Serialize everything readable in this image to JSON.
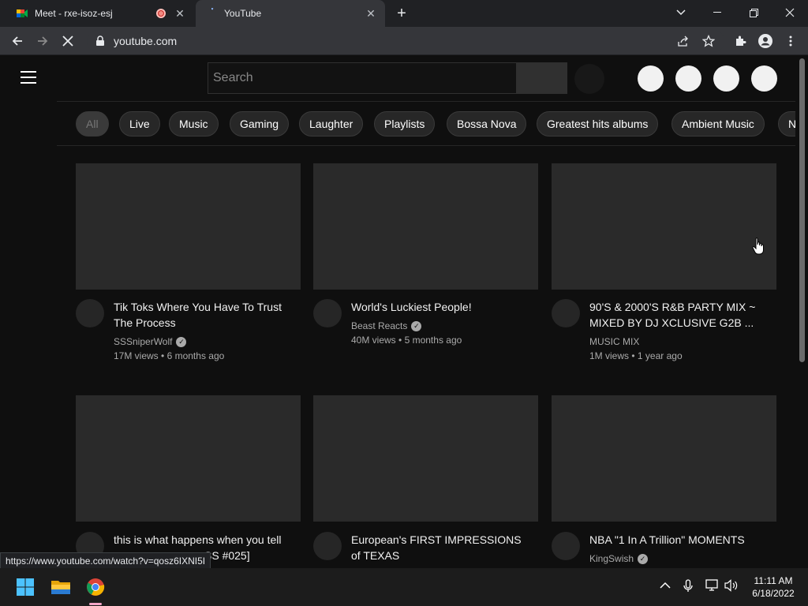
{
  "browser": {
    "tabs": [
      {
        "title": "Meet - rxe-isoz-esj",
        "active": false
      },
      {
        "title": "YouTube",
        "active": true
      }
    ],
    "url": "youtube.com",
    "status_url": "https://www.youtube.com/watch?v=qosz6IXNI5I"
  },
  "youtube": {
    "search_placeholder": "Search",
    "chips": [
      "All",
      "Live",
      "Music",
      "Gaming",
      "Laughter",
      "Playlists",
      "Bossa Nova",
      "Greatest hits albums",
      "Ambient Music",
      "N"
    ],
    "videos": [
      {
        "title": "Tik Toks Where You Have To Trust The Process",
        "channel": "SSSniperWolf",
        "verified": true,
        "views": "17M views",
        "age": "6 months ago"
      },
      {
        "title": "World's Luckiest People!",
        "channel": "Beast Reacts",
        "verified": true,
        "views": "40M views",
        "age": "5 months ago"
      },
      {
        "title": "90'S & 2000'S R&B PARTY MIX ~ MIXED BY DJ XCLUSIVE G2B ...",
        "channel": "MUSIC MIX",
        "verified": false,
        "views": "1M views",
        "age": "1 year ago"
      },
      {
        "title": "this is what happens when you tell",
        "title_line2": "SS #025]",
        "channel": "",
        "verified": false,
        "views": "",
        "age": ""
      },
      {
        "title": "European's FIRST IMPRESSIONS of TEXAS",
        "channel": "",
        "verified": false,
        "views": "",
        "age": ""
      },
      {
        "title": "NBA \"1 In A Trillion\" MOMENTS",
        "channel": "KingSwish",
        "verified": true,
        "views": "",
        "age": ""
      }
    ],
    "meta_separator": "•"
  },
  "taskbar": {
    "time": "11:11 AM",
    "date": "6/18/2022"
  }
}
